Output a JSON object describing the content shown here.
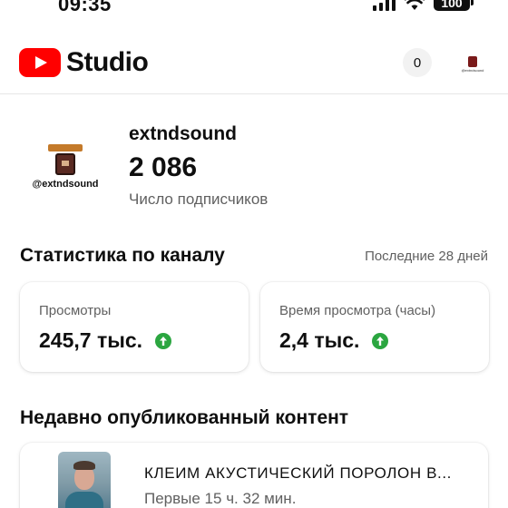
{
  "status_bar": {
    "time": "09:35",
    "battery": "100"
  },
  "header": {
    "app_name": "Studio",
    "notification_count": "0",
    "avatar_handle": "@extndsound"
  },
  "channel": {
    "avatar_handle": "@extndsound",
    "name": "extndsound",
    "subscribers": "2 086",
    "subscribers_label": "Число подписчиков"
  },
  "stats": {
    "title": "Статистика по каналу",
    "period": "Последние 28 дней",
    "cards": [
      {
        "label": "Просмотры",
        "value": "245,7 тыс.",
        "trend": "up"
      },
      {
        "label": "Время просмотра (часы)",
        "value": "2,4 тыс.",
        "trend": "up"
      }
    ]
  },
  "recent": {
    "title": "Недавно опубликованный контент",
    "item": {
      "title": "КЛЕИМ АКУСТИЧЕСКИЙ ПОРОЛОН В...",
      "meta": "Первые 15 ч. 32 мин."
    }
  },
  "colors": {
    "brand_red": "#ff0000",
    "trend_green": "#2ba640",
    "text_secondary": "#606060"
  }
}
